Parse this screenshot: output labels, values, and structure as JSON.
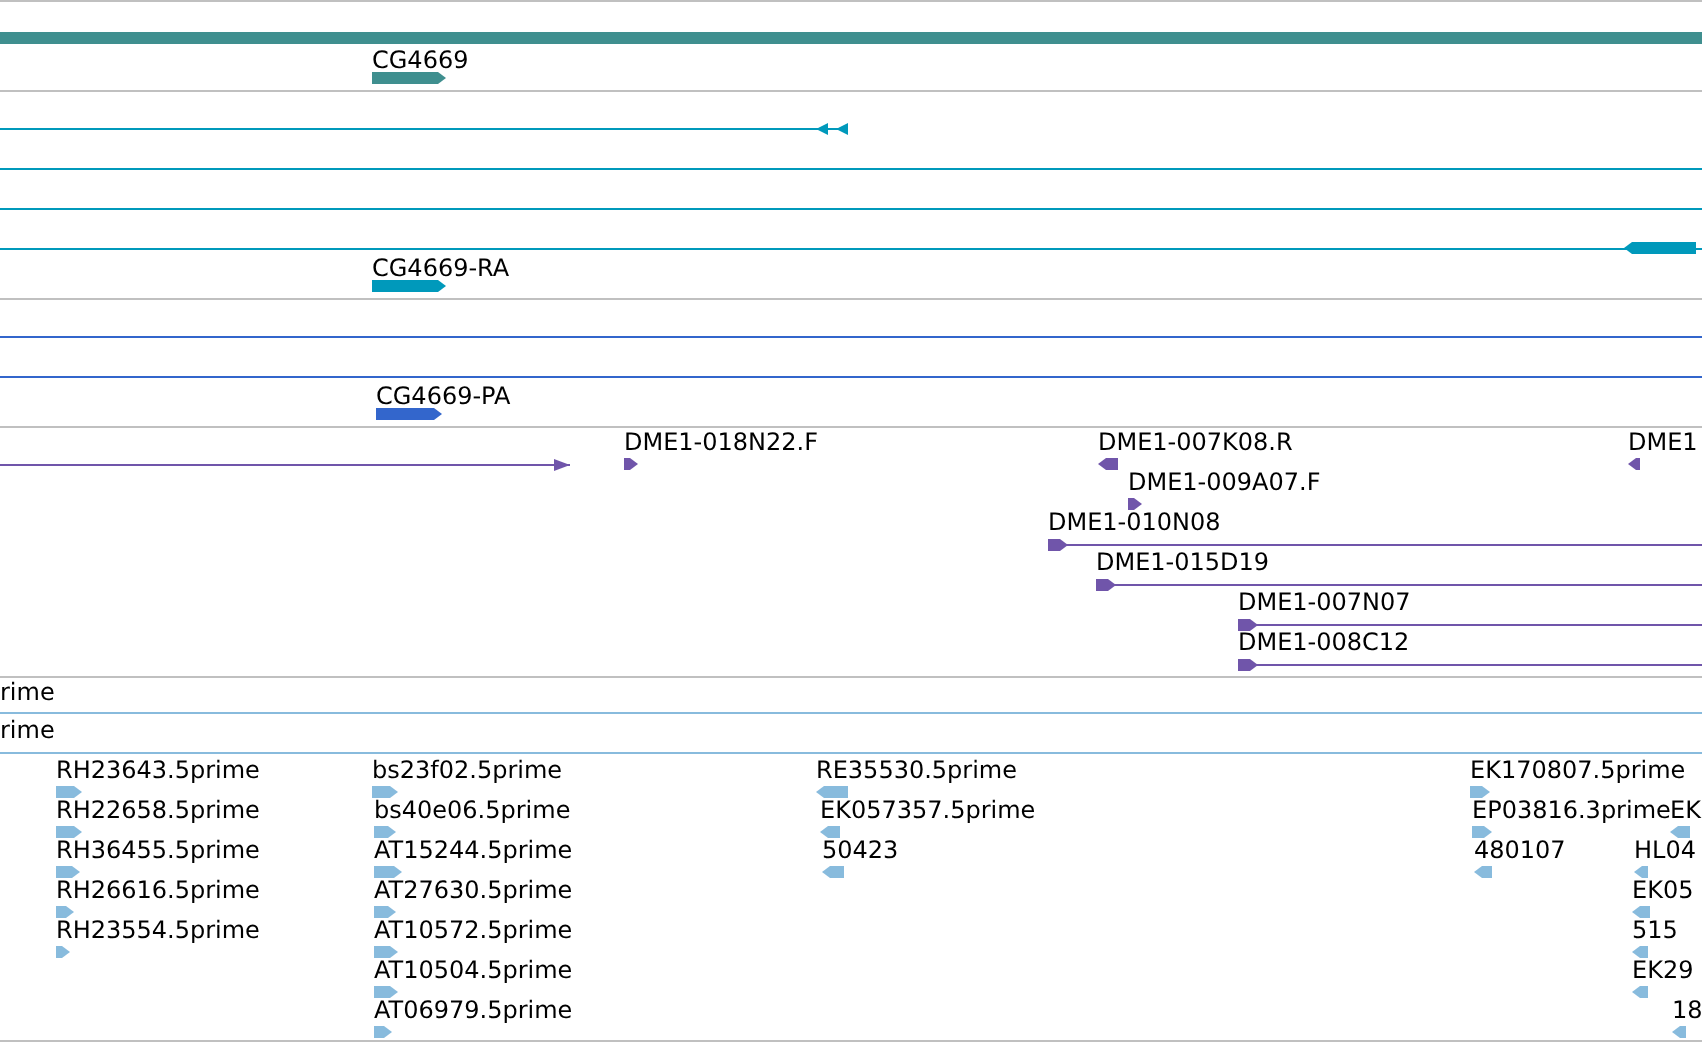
{
  "tracks": [
    {
      "features": [
        {
          "label": "CG4669",
          "reverse": false
        }
      ]
    },
    {
      "features": [
        {
          "reverse": true
        },
        {
          "reverse": true
        },
        {
          "label": "CG4669-RA",
          "reverse": false
        }
      ]
    },
    {
      "features": [
        {
          "label": "CG4669-PA",
          "reverse": false
        }
      ]
    },
    {
      "features": [
        {
          "reverse": false
        },
        {
          "label": "DME1-018N22.F",
          "reverse": false
        },
        {
          "label": "DME1-007K08.R",
          "reverse": true
        },
        {
          "label": "DME1",
          "reverse": true
        },
        {
          "label": "DME1-009A07.F",
          "reverse": false
        },
        {
          "label": "DME1-010N08",
          "reverse": false
        },
        {
          "label": "DME1-015D19",
          "reverse": false
        },
        {
          "label": "DME1-007N07",
          "reverse": false
        },
        {
          "label": "DME1-008C12",
          "reverse": false
        }
      ]
    },
    {
      "features": [
        {
          "label": "rime"
        },
        {
          "label": "rime"
        },
        {
          "label": "RH23643.5prime",
          "reverse": false
        },
        {
          "label": "RH22658.5prime",
          "reverse": false
        },
        {
          "label": "RH36455.5prime",
          "reverse": false
        },
        {
          "label": "RH26616.5prime",
          "reverse": false
        },
        {
          "label": "RH23554.5prime",
          "reverse": false
        },
        {
          "label": "bs23f02.5prime",
          "reverse": false
        },
        {
          "label": "bs40e06.5prime",
          "reverse": false
        },
        {
          "label": "AT15244.5prime",
          "reverse": false
        },
        {
          "label": "AT27630.5prime",
          "reverse": false
        },
        {
          "label": "AT10572.5prime",
          "reverse": false
        },
        {
          "label": "AT10504.5prime",
          "reverse": false
        },
        {
          "label": "AT06979.5prime",
          "reverse": false
        },
        {
          "label": "RE35530.5prime",
          "reverse": true
        },
        {
          "label": "EK057357.5prime",
          "reverse": true
        },
        {
          "label": "50423",
          "reverse": true
        },
        {
          "label": "EK170807.5prime",
          "reverse": false
        },
        {
          "label": "EP03816.3prime",
          "reverse": false
        },
        {
          "label": "480107",
          "reverse": true
        },
        {
          "label": "EK",
          "reverse": true
        },
        {
          "label": "HL04",
          "reverse": true
        },
        {
          "label": "EK05",
          "reverse": true
        },
        {
          "label": "515",
          "reverse": true
        },
        {
          "label": "EK29",
          "reverse": true
        },
        {
          "label": "18",
          "reverse": true
        }
      ]
    }
  ]
}
